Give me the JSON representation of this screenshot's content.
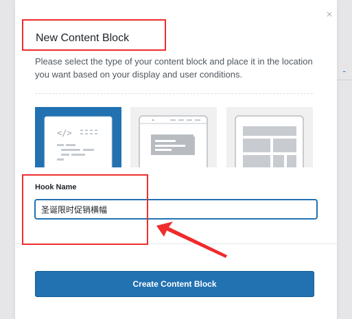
{
  "modal": {
    "title": "New Content Block",
    "description": "Please select the type of your content block and place it in the location you want based on your display and user conditions.",
    "close_glyph": "×"
  },
  "block_types": [
    {
      "icon": "code-block-icon",
      "active": true
    },
    {
      "icon": "layout-block-icon",
      "active": false
    },
    {
      "icon": "template-block-icon",
      "active": false
    }
  ],
  "hook": {
    "label": "Hook Name",
    "value": "圣诞限时促销横幅"
  },
  "footer": {
    "create_label": "Create Content Block"
  },
  "annotation": {
    "color": "#ef2b2b",
    "arrow_icon": "red-arrow-icon"
  },
  "colors": {
    "accent": "#2271b1",
    "card_inactive": "#f0f0f1"
  }
}
